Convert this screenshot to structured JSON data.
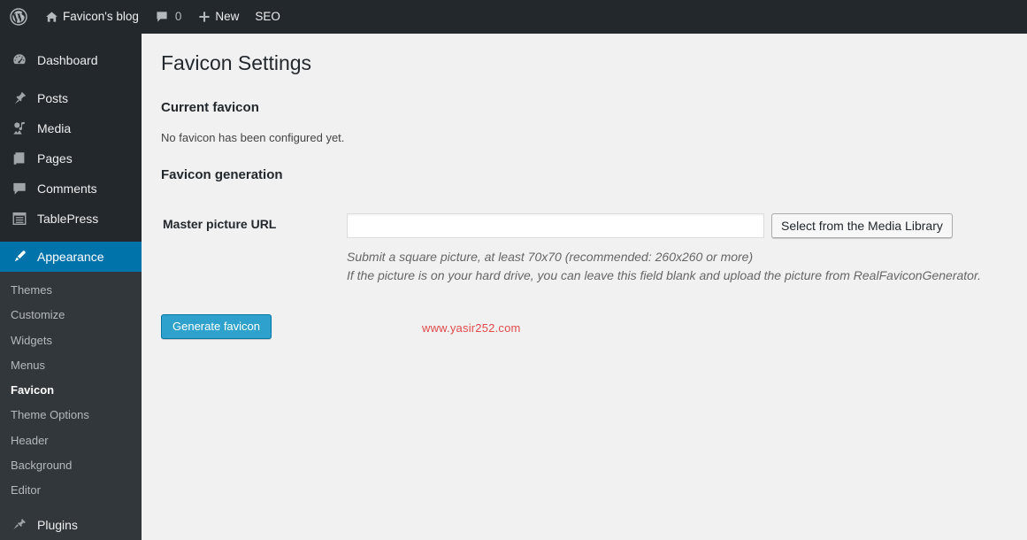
{
  "adminbar": {
    "logo_icon": "wordpress-logo-icon",
    "site_home_icon": "home-icon",
    "site_name": "Favicon's blog",
    "comments_icon": "comment-bubble-icon",
    "comments_count": "0",
    "new_icon": "plus-icon",
    "new_label": "New",
    "seo_label": "SEO"
  },
  "sidebar": {
    "items": [
      {
        "label": "Dashboard",
        "icon": "dashboard-icon",
        "name": "dashboard"
      },
      {
        "label": "Posts",
        "icon": "pin-icon",
        "name": "posts"
      },
      {
        "label": "Media",
        "icon": "media-icon",
        "name": "media"
      },
      {
        "label": "Pages",
        "icon": "pages-icon",
        "name": "pages"
      },
      {
        "label": "Comments",
        "icon": "comment-bubble-icon",
        "name": "comments"
      },
      {
        "label": "TablePress",
        "icon": "table-icon",
        "name": "tablepress"
      },
      {
        "label": "Appearance",
        "icon": "brush-icon",
        "name": "appearance"
      },
      {
        "label": "Plugins",
        "icon": "plug-icon",
        "name": "plugins"
      }
    ],
    "submenu": [
      {
        "label": "Themes",
        "name": "themes"
      },
      {
        "label": "Customize",
        "name": "customize"
      },
      {
        "label": "Widgets",
        "name": "widgets"
      },
      {
        "label": "Menus",
        "name": "menus"
      },
      {
        "label": "Favicon",
        "name": "favicon"
      },
      {
        "label": "Theme Options",
        "name": "theme-options"
      },
      {
        "label": "Header",
        "name": "header"
      },
      {
        "label": "Background",
        "name": "background"
      },
      {
        "label": "Editor",
        "name": "editor"
      }
    ],
    "active_item": "Appearance",
    "active_subitem": "Favicon",
    "colors": {
      "background": "#23282d",
      "submenu_background": "#32373c",
      "active": "#0073aa"
    }
  },
  "main": {
    "page_title": "Favicon Settings",
    "current_section_heading": "Current favicon",
    "current_favicon_text": "No favicon has been configured yet.",
    "generation_heading": "Favicon generation",
    "field_label": "Master picture URL",
    "field_value": "",
    "field_placeholder": "",
    "media_library_button": "Select from the Media Library",
    "hint_line_1": "Submit a square picture, at least 70x70 (recommended: 260x260 or more)",
    "hint_line_2": "If the picture is on your hard drive, you can leave this field blank and upload the picture from RealFaviconGenerator.",
    "generate_button": "Generate favicon",
    "watermark": "www.yasir252.com",
    "watermark_color": "#e04a4a",
    "primary_button_color": "#2ea2cc"
  }
}
